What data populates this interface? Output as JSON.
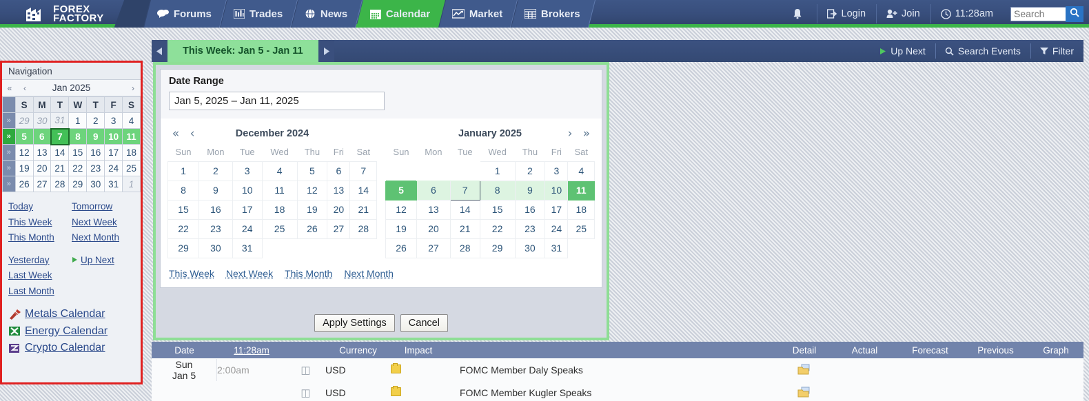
{
  "header": {
    "logo": {
      "line1": "FOREX",
      "line2": "FACTORY"
    },
    "nav": [
      {
        "label": "Forums",
        "icon": "chat-icon",
        "active": false
      },
      {
        "label": "Trades",
        "icon": "bars-icon",
        "active": false
      },
      {
        "label": "News",
        "icon": "globe-icon",
        "active": false
      },
      {
        "label": "Calendar",
        "icon": "calendar-icon",
        "active": true
      },
      {
        "label": "Market",
        "icon": "market-icon",
        "active": false
      },
      {
        "label": "Brokers",
        "icon": "brokers-icon",
        "active": false
      }
    ],
    "right": {
      "notification_icon": "bell-icon",
      "login": "Login",
      "join": "Join",
      "time": "11:28am",
      "search_placeholder": "Search",
      "search_value": ""
    },
    "accent_green": "#3cb549",
    "bar_blue": "#384e7c"
  },
  "subbar": {
    "prev_label": "◀",
    "next_label": "▶",
    "date_pill": "This Week: Jan 5 - Jan 11",
    "up_next": "Up Next",
    "search_events": "Search Events",
    "filter": "Filter"
  },
  "navigation": {
    "title": "Navigation",
    "mini_calendar": {
      "prev_year": "«",
      "prev_month": "‹",
      "month_label": "Jan 2025",
      "next_month": "›",
      "weekday_headers": [
        "S",
        "M",
        "T",
        "W",
        "T",
        "F",
        "S"
      ],
      "week_chevron": "»",
      "weeks": [
        {
          "selected": false,
          "days": [
            {
              "n": "29",
              "out": true
            },
            {
              "n": "30",
              "out": true
            },
            {
              "n": "31",
              "out": true
            },
            {
              "n": "1"
            },
            {
              "n": "2"
            },
            {
              "n": "3"
            },
            {
              "n": "4"
            }
          ]
        },
        {
          "selected": true,
          "days": [
            {
              "n": "5"
            },
            {
              "n": "6"
            },
            {
              "n": "7",
              "today": true
            },
            {
              "n": "8"
            },
            {
              "n": "9"
            },
            {
              "n": "10"
            },
            {
              "n": "11"
            }
          ]
        },
        {
          "selected": false,
          "days": [
            {
              "n": "12"
            },
            {
              "n": "13"
            },
            {
              "n": "14"
            },
            {
              "n": "15"
            },
            {
              "n": "16"
            },
            {
              "n": "17"
            },
            {
              "n": "18"
            }
          ]
        },
        {
          "selected": false,
          "days": [
            {
              "n": "19"
            },
            {
              "n": "20"
            },
            {
              "n": "21"
            },
            {
              "n": "22"
            },
            {
              "n": "23"
            },
            {
              "n": "24"
            },
            {
              "n": "25"
            }
          ]
        },
        {
          "selected": false,
          "days": [
            {
              "n": "26"
            },
            {
              "n": "27"
            },
            {
              "n": "28"
            },
            {
              "n": "29"
            },
            {
              "n": "30"
            },
            {
              "n": "31"
            },
            {
              "n": "1",
              "out": true
            }
          ]
        }
      ]
    },
    "links": {
      "today": "Today",
      "tomorrow": "Tomorrow",
      "this_week": "This Week",
      "next_week": "Next Week",
      "this_month": "This Month",
      "next_month": "Next Month",
      "yesterday": "Yesterday",
      "up_next": "Up Next",
      "last_week": "Last Week",
      "last_month": "Last Month"
    },
    "calendars": [
      {
        "label": "Metals Calendar",
        "icon": "metals-icon",
        "color": "#b03a2e"
      },
      {
        "label": "Energy Calendar",
        "icon": "energy-icon",
        "color": "#1f8b3c"
      },
      {
        "label": "Crypto Calendar",
        "icon": "crypto-icon",
        "color": "#5b3d8c"
      }
    ],
    "border_color": "#e02020"
  },
  "date_range_panel": {
    "title": "Date Range",
    "input_value": "Jan 5, 2025 – Jan 11, 2025",
    "left_calendar": {
      "prev_year": "«",
      "prev_month": "‹",
      "title": "December 2024",
      "weekdays": [
        "Sun",
        "Mon",
        "Tue",
        "Wed",
        "Thu",
        "Fri",
        "Sat"
      ],
      "weeks": [
        [
          {
            "n": "1"
          },
          {
            "n": "2"
          },
          {
            "n": "3"
          },
          {
            "n": "4"
          },
          {
            "n": "5"
          },
          {
            "n": "6"
          },
          {
            "n": "7"
          }
        ],
        [
          {
            "n": "8"
          },
          {
            "n": "9"
          },
          {
            "n": "10"
          },
          {
            "n": "11"
          },
          {
            "n": "12"
          },
          {
            "n": "13"
          },
          {
            "n": "14"
          }
        ],
        [
          {
            "n": "15"
          },
          {
            "n": "16"
          },
          {
            "n": "17"
          },
          {
            "n": "18"
          },
          {
            "n": "19"
          },
          {
            "n": "20"
          },
          {
            "n": "21"
          }
        ],
        [
          {
            "n": "22"
          },
          {
            "n": "23"
          },
          {
            "n": "24"
          },
          {
            "n": "25"
          },
          {
            "n": "26"
          },
          {
            "n": "27"
          },
          {
            "n": "28"
          }
        ],
        [
          {
            "n": "29"
          },
          {
            "n": "30"
          },
          {
            "n": "31"
          },
          {
            "n": "",
            "empty": true
          },
          {
            "n": "",
            "empty": true
          },
          {
            "n": "",
            "empty": true
          },
          {
            "n": "",
            "empty": true
          }
        ]
      ]
    },
    "right_calendar": {
      "next_month": "›",
      "next_year": "»",
      "title": "January 2025",
      "weekdays": [
        "Sun",
        "Mon",
        "Tue",
        "Wed",
        "Thu",
        "Fri",
        "Sat"
      ],
      "weeks": [
        [
          {
            "n": "",
            "empty": true
          },
          {
            "n": "",
            "empty": true
          },
          {
            "n": "",
            "empty": true
          },
          {
            "n": "1"
          },
          {
            "n": "2"
          },
          {
            "n": "3"
          },
          {
            "n": "4"
          }
        ],
        [
          {
            "n": "5",
            "edge": true
          },
          {
            "n": "6",
            "range": true
          },
          {
            "n": "7",
            "range": true,
            "focus": true
          },
          {
            "n": "8",
            "range": true
          },
          {
            "n": "9",
            "range": true
          },
          {
            "n": "10",
            "range": true
          },
          {
            "n": "11",
            "edge": true
          }
        ],
        [
          {
            "n": "12"
          },
          {
            "n": "13"
          },
          {
            "n": "14"
          },
          {
            "n": "15"
          },
          {
            "n": "16"
          },
          {
            "n": "17"
          },
          {
            "n": "18"
          }
        ],
        [
          {
            "n": "19"
          },
          {
            "n": "20"
          },
          {
            "n": "21"
          },
          {
            "n": "22"
          },
          {
            "n": "23"
          },
          {
            "n": "24"
          },
          {
            "n": "25"
          }
        ],
        [
          {
            "n": "26"
          },
          {
            "n": "27"
          },
          {
            "n": "28"
          },
          {
            "n": "29"
          },
          {
            "n": "30"
          },
          {
            "n": "31"
          },
          {
            "n": "",
            "empty": true
          }
        ]
      ]
    },
    "quick_links": [
      "This Week",
      "Next Week",
      "This Month",
      "Next Month"
    ],
    "apply_label": "Apply Settings",
    "cancel_label": "Cancel",
    "border_color": "#8ede95"
  },
  "calendar_table": {
    "columns": {
      "date": "Date",
      "time": "11:28am",
      "currency": "Currency",
      "impact": "Impact",
      "detail": "Detail",
      "actual": "Actual",
      "forecast": "Forecast",
      "previous": "Previous",
      "graph": "Graph"
    },
    "rows": [
      {
        "date_day": "Sun",
        "date_date": "Jan 5",
        "time": "2:00am",
        "speaker_icon": "speaker-icon",
        "currency": "USD",
        "impact": "medium-yellow",
        "event": "FOMC Member Daly Speaks",
        "detail_icon": "detail-folder-icon",
        "actual": "",
        "forecast": "",
        "previous": "",
        "graph": ""
      },
      {
        "date_day": "",
        "date_date": "",
        "time": "",
        "speaker_icon": "speaker-icon",
        "currency": "USD",
        "impact": "medium-yellow",
        "event": "FOMC Member Kugler Speaks",
        "detail_icon": "detail-folder-icon",
        "actual": "",
        "forecast": "",
        "previous": "",
        "graph": ""
      }
    ]
  }
}
